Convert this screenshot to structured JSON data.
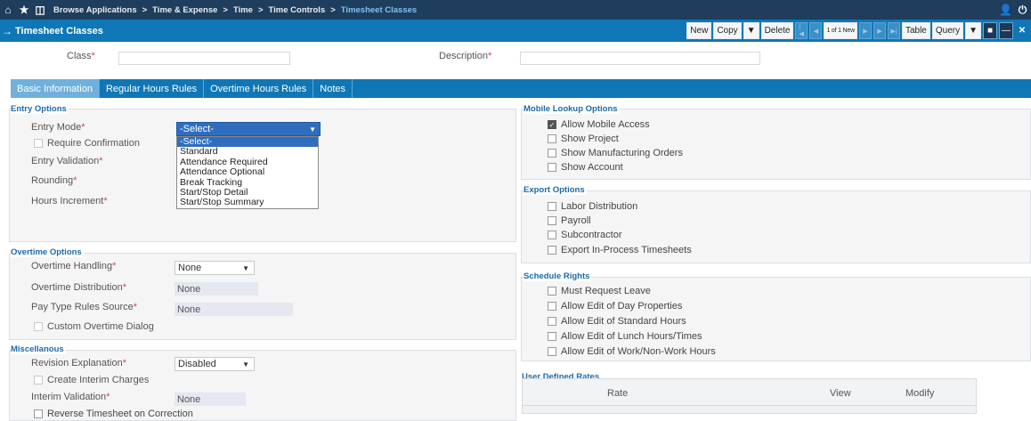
{
  "nav": {
    "icons": [
      "home-icon",
      "star-icon",
      "window-icon"
    ],
    "crumbs": [
      "Browse Applications",
      ">",
      "Time & Expense",
      ">",
      "Time",
      ">",
      "Time Controls",
      ">",
      "Timesheet Classes"
    ],
    "right_icons": [
      "user-icon",
      "power-icon"
    ]
  },
  "toolbar": {
    "title": "Timesheet Classes",
    "new": "New",
    "copy": "Copy",
    "delete": "Delete",
    "record": "1 of 1 New",
    "table": "Table",
    "query": "Query"
  },
  "header": {
    "class_label": "Class",
    "class_value": "",
    "description_label": "Description",
    "description_value": ""
  },
  "tabs": [
    "Basic Information",
    "Regular Hours Rules",
    "Overtime Hours Rules",
    "Notes"
  ],
  "entry": {
    "title": "Entry Options",
    "entry_mode": "Entry Mode",
    "require_confirmation": "Require Confirmation",
    "entry_validation": "Entry Validation",
    "rounding": "Rounding",
    "hours_increment": "Hours Increment",
    "dropdown_selected": "-Select-",
    "options": [
      "-Select-",
      "Standard",
      "Attendance Required",
      "Attendance Optional",
      "Break Tracking",
      "Start/Stop Detail",
      "Start/Stop Summary"
    ]
  },
  "overtime": {
    "title": "Overtime Options",
    "handling": "Overtime Handling",
    "handling_value": "None",
    "distribution": "Overtime Distribution",
    "distribution_value": "None",
    "pay_type": "Pay Type Rules Source",
    "pay_type_value": "None",
    "custom_dialog": "Custom Overtime Dialog"
  },
  "misc": {
    "title": "Miscellanous",
    "revision": "Revision Explanation",
    "revision_value": "Disabled",
    "create_interim": "Create Interim Charges",
    "interim_validation": "Interim Validation",
    "interim_value": "None",
    "reverse": "Reverse Timesheet on Correction"
  },
  "mobile": {
    "title": "Mobile Lookup Options",
    "items": [
      "Allow Mobile Access",
      "Show Project",
      "Show Manufacturing Orders",
      "Show Account"
    ]
  },
  "export": {
    "title": "Export Options",
    "items": [
      "Labor Distribution",
      "Payroll",
      "Subcontractor",
      "Export In-Process Timesheets"
    ]
  },
  "schedule": {
    "title": "Schedule Rights",
    "items": [
      "Must Request Leave",
      "Allow Edit of Day Properties",
      "Allow Edit of Standard Hours",
      "Allow Edit of Lunch Hours/Times",
      "Allow Edit of Work/Non-Work Hours"
    ]
  },
  "udr": {
    "title": "User Defined Rates",
    "cols": [
      "Rate",
      "View",
      "Modify"
    ]
  }
}
